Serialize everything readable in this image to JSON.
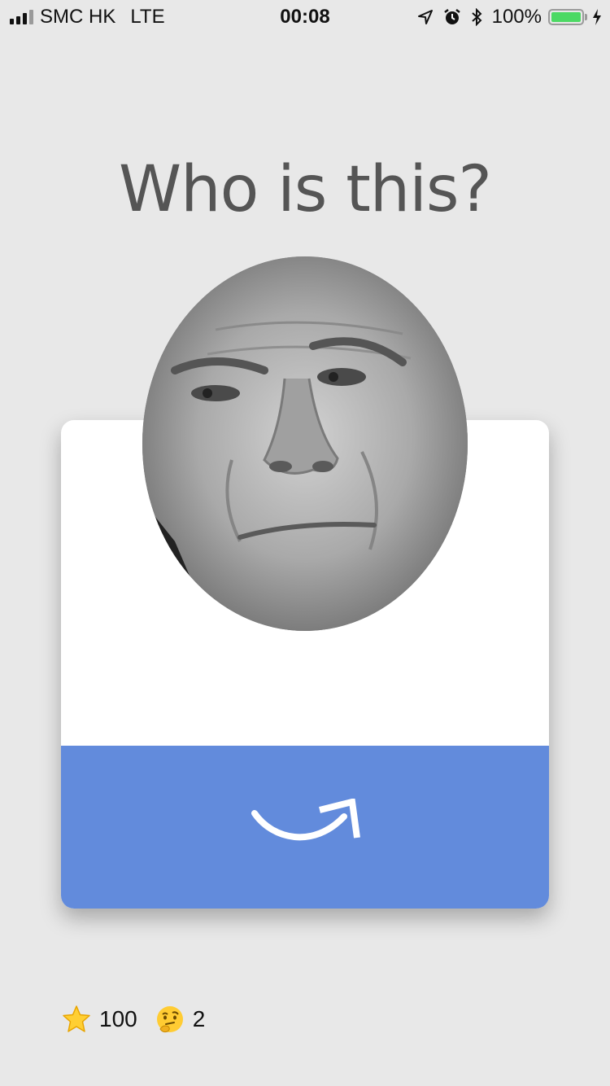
{
  "status_bar": {
    "carrier": "SMC HK",
    "network": "LTE",
    "time": "00:08",
    "battery_percent": "100%",
    "battery_level": 1.0,
    "battery_color": "#4cd964",
    "icons": [
      "signal-icon",
      "location-icon",
      "alarm-icon",
      "bluetooth-icon",
      "battery-icon",
      "charging-icon"
    ]
  },
  "quiz": {
    "title": "Who is this?",
    "photo_icon": "face-photo",
    "action_icon": "curved-arrow-icon",
    "action_color": "#628bdc"
  },
  "stats": {
    "stars_icon": "star-icon",
    "stars": "100",
    "thinking_icon": "thinking-face-icon",
    "thinking": "2"
  }
}
